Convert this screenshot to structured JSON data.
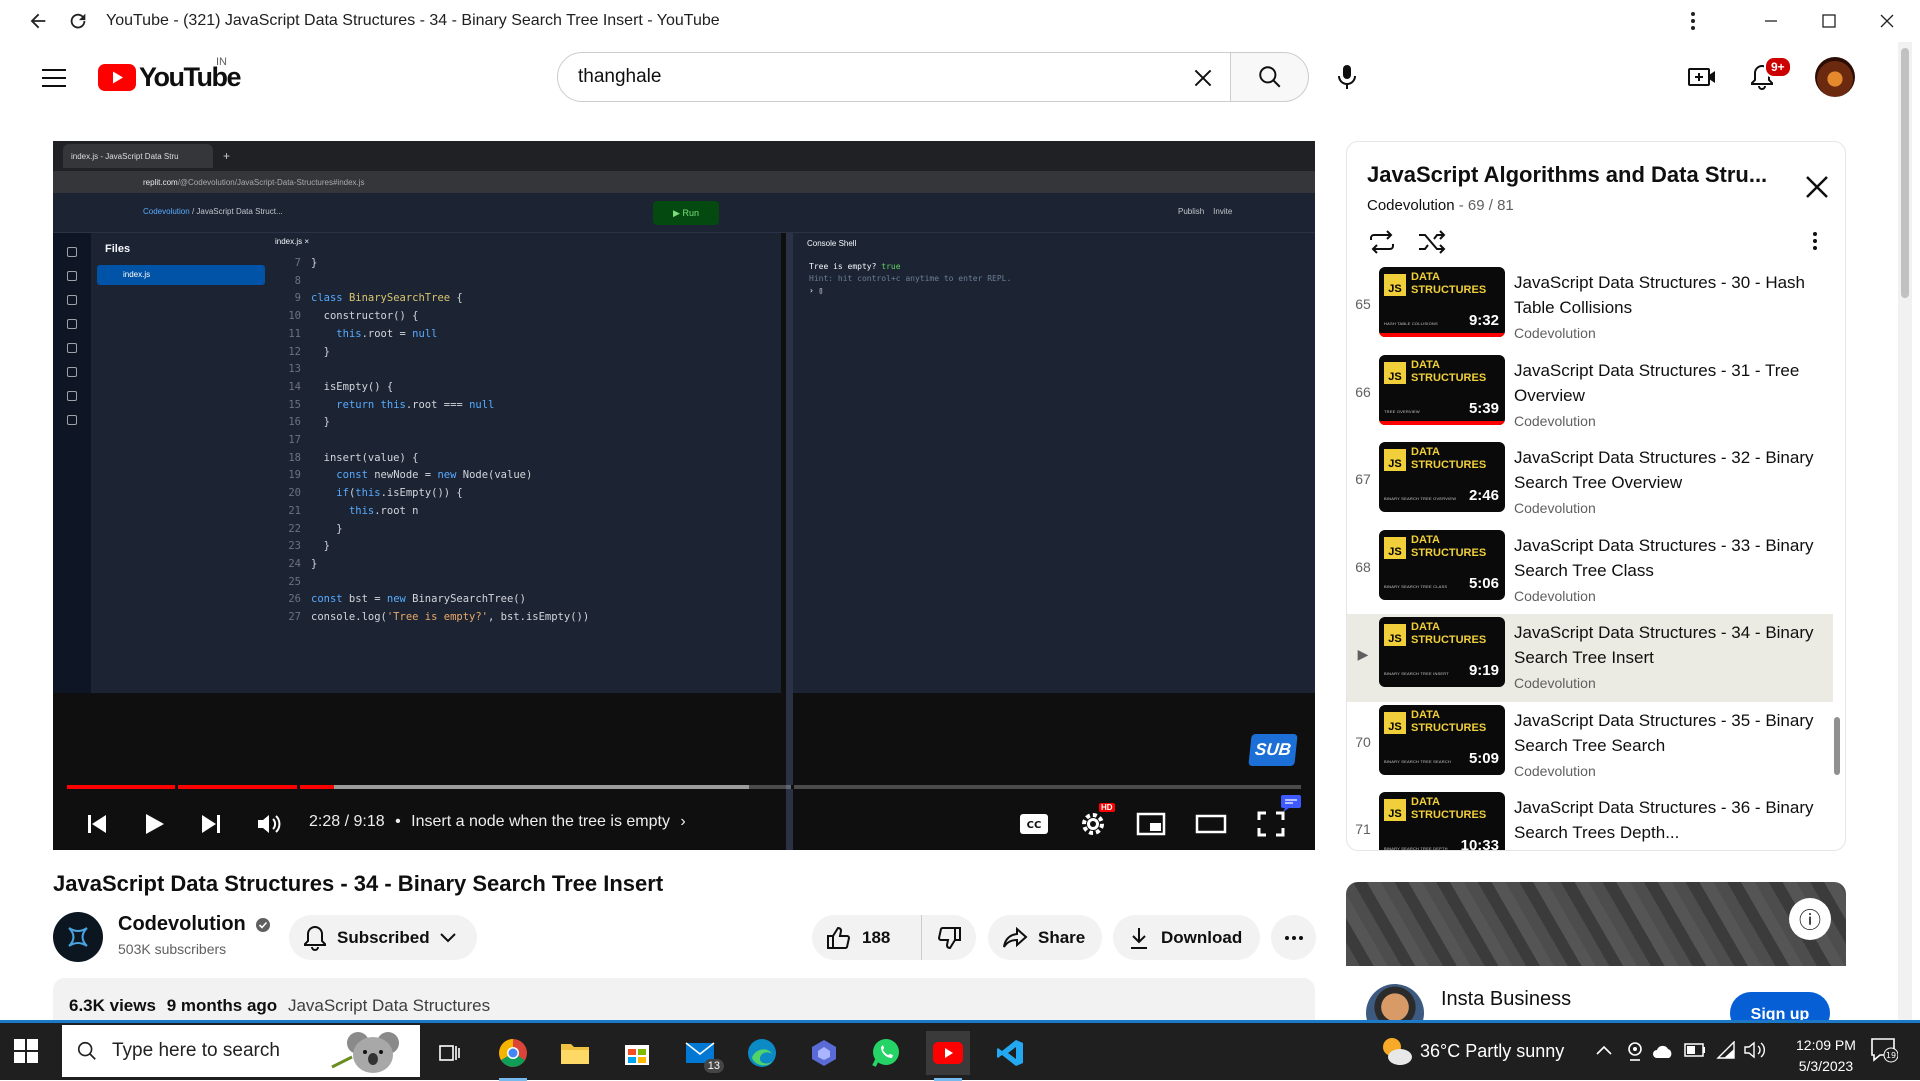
{
  "window": {
    "title": "YouTube - (321) JavaScript Data Structures - 34 - Binary Search Tree Insert - YouTube"
  },
  "masthead": {
    "logo_text": "YouTube",
    "country_code": "IN",
    "search_value": "thanghale",
    "notification_count": "9+"
  },
  "player": {
    "ide_tab": "index.js - JavaScript Data Stru",
    "ide_url_host": "replit.com",
    "ide_url_path": "/@Codevolution/JavaScript-Data-Structures#index.js",
    "ide_owner": "Codevolution",
    "ide_project": "/ JavaScript Data Struct...",
    "ide_run": "▶  Run",
    "ide_publish": "Publish",
    "ide_invite": "Invite",
    "ide_files_header": "Files",
    "ide_file_selected": "index.js",
    "editor_tab": "index.js ×",
    "console_tabs": "Console   Shell",
    "console_line1": "Tree is empty?",
    "console_line1_val": "true",
    "console_hint": "Hint: hit control+c anytime to enter REPL.",
    "sub_logo": "SUB",
    "time": "2:28 / 9:18",
    "chapter": "Insert a node when the tree is empty",
    "progress_played": 0.216,
    "progress_loaded": 0.553,
    "hd_badge": "HD"
  },
  "video": {
    "title": "JavaScript Data Structures - 34 - Binary Search Tree Insert",
    "channel": "Codevolution",
    "subscribers": "503K subscribers",
    "subscribed_label": "Subscribed",
    "likes": "188",
    "share_label": "Share",
    "download_label": "Download",
    "views": "6.3K views",
    "age": "9 months ago",
    "hashtag": "JavaScript Data Structures"
  },
  "playlist": {
    "title": "JavaScript Algorithms and Data Stru...",
    "channel": "Codevolution",
    "position": "69 / 81",
    "items": [
      {
        "idx": "65",
        "title": "JavaScript Data Structures - 30 - Hash Table Collisions",
        "channel": "Codevolution",
        "duration": "9:32",
        "caption": "HASH TABLE COLLISIONS",
        "active": false
      },
      {
        "idx": "66",
        "title": "JavaScript Data Structures - 31 - Tree Overview",
        "channel": "Codevolution",
        "duration": "5:39",
        "caption": "TREE OVERVIEW",
        "active": false
      },
      {
        "idx": "67",
        "title": "JavaScript Data Structures - 32 - Binary Search Tree Overview",
        "channel": "Codevolution",
        "duration": "2:46",
        "caption": "BINARY SEARCH TREE OVERVIEW",
        "active": false
      },
      {
        "idx": "68",
        "title": "JavaScript Data Structures - 33 - Binary Search Tree Class",
        "channel": "Codevolution",
        "duration": "5:06",
        "caption": "BINARY SEARCH TREE CLASS",
        "active": false
      },
      {
        "idx": "▶",
        "title": "JavaScript Data Structures - 34 - Binary Search Tree Insert",
        "channel": "Codevolution",
        "duration": "9:19",
        "caption": "BINARY SEARCH TREE INSERT",
        "active": true
      },
      {
        "idx": "70",
        "title": "JavaScript Data Structures - 35 - Binary Search Tree Search",
        "channel": "Codevolution",
        "duration": "5:09",
        "caption": "BINARY SEARCH TREE SEARCH",
        "active": false
      },
      {
        "idx": "71",
        "title": "JavaScript Data Structures - 36 - Binary Search Trees Depth...",
        "channel": "Codevolution",
        "duration": "10:33",
        "caption": "BINARY SEARCH TREE DEPTH",
        "active": false
      }
    ],
    "thumb_label_1": "DATA",
    "thumb_label_2": "STRUCTURES",
    "thumb_js": "JS"
  },
  "ad": {
    "name": "Insta Business",
    "cta": "Sign up"
  },
  "taskbar": {
    "search_placeholder": "Type here to search",
    "mail_badge": "13",
    "weather": "36°C  Partly sunny",
    "time": "12:09 PM",
    "date": "5/3/2023",
    "notif_count": "19"
  },
  "colors": {
    "youtube_red": "#ff0000",
    "playlist_active_bg": "#ecebe3",
    "taskbar_bg": "#1f1f1f",
    "signup_blue": "#065fd4"
  }
}
